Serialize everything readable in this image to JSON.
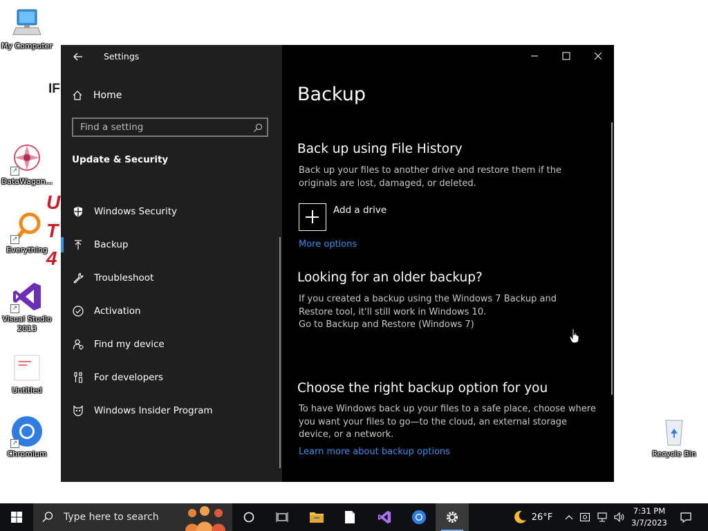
{
  "desktop": {
    "icons": [
      {
        "label": "My Computer"
      },
      {
        "label": "DataWagon..."
      },
      {
        "label": "Everything"
      },
      {
        "label": "Visual Studio 2013"
      },
      {
        "label": "Untitled"
      },
      {
        "label": "Chromium"
      },
      {
        "label": "Recycle Bin"
      }
    ],
    "bg_text_a": "IF",
    "bg_text_b": "U",
    "bg_text_c": "T",
    "bg_text_d": "4"
  },
  "window": {
    "title": "Settings",
    "nav": {
      "home": "Home",
      "search_placeholder": "Find a setting",
      "section_title": "Update & Security",
      "items": [
        {
          "label": "Windows Security",
          "icon": "shield-icon"
        },
        {
          "label": "Backup",
          "icon": "backup-arrow-icon",
          "selected": true
        },
        {
          "label": "Troubleshoot",
          "icon": "wrench-icon"
        },
        {
          "label": "Activation",
          "icon": "check-circle-icon"
        },
        {
          "label": "Find my device",
          "icon": "person-location-icon"
        },
        {
          "label": "For developers",
          "icon": "developer-tools-icon"
        },
        {
          "label": "Windows Insider Program",
          "icon": "insider-cat-icon"
        }
      ]
    },
    "content": {
      "page_title": "Backup",
      "file_history": {
        "heading": "Back up using File History",
        "description": "Back up your files to another drive and restore them if the originals are lost, damaged, or deleted.",
        "add_drive": "Add a drive",
        "more_options": "More options"
      },
      "older_backup": {
        "heading": "Looking for an older backup?",
        "description": "If you created a backup using the Windows 7 Backup and Restore tool, it'll still work in Windows 10.",
        "link": "Go to Backup and Restore (Windows 7)"
      },
      "right_option": {
        "heading": "Choose the right backup option for you",
        "description": "To have Windows back up your files to a safe place, choose where you want your files to go—to the cloud, an external storage device, or a network.",
        "link": "Learn more about backup options"
      }
    }
  },
  "taskbar": {
    "search_placeholder": "Type here to search",
    "weather_temp": "26°F",
    "time": "7:31 PM",
    "date": "3/7/2023"
  },
  "colors": {
    "accent": "#3b8eea",
    "window_bg": "#000000",
    "nav_bg": "#1f1f1f"
  }
}
